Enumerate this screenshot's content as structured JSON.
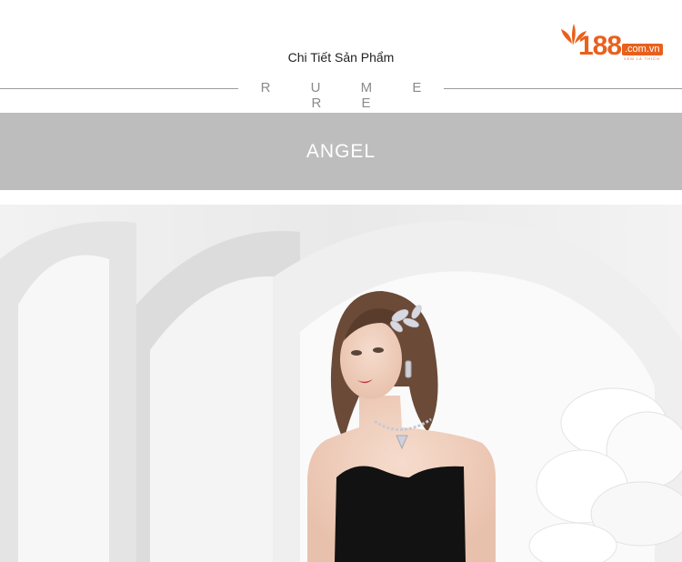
{
  "header": {
    "title": "Chi Tiết Sản Phẩm",
    "logo": {
      "number": "188",
      "domain": ".com.vn",
      "tagline": "XEM LÀ THÍCH",
      "color": "#e8601c",
      "icon": "leaf-icon"
    }
  },
  "brand": {
    "name": "R U M E R E"
  },
  "banner": {
    "text": "ANGEL",
    "background": "#bdbdbd"
  },
  "product_image": {
    "description_icon": "model-black-dress-photo"
  }
}
